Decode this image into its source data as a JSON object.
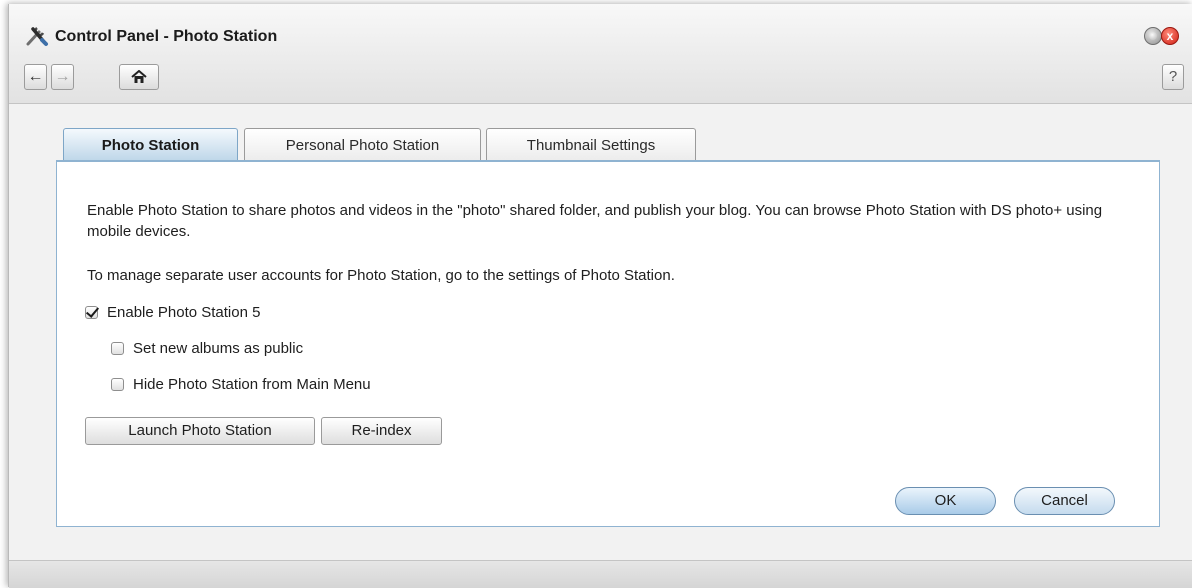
{
  "window": {
    "title": "Control Panel - Photo Station",
    "app_icon": "control-panel-tools-icon",
    "controls": {
      "minimize_icon": "minimize-icon",
      "close_icon": "close-icon",
      "close_glyph": "x"
    }
  },
  "toolbar": {
    "back_glyph": "←",
    "forward_glyph": "→",
    "home_glyph": "⌂",
    "help_label": "?"
  },
  "tabs": [
    {
      "label": "Photo Station",
      "active": true
    },
    {
      "label": "Personal Photo Station",
      "active": false
    },
    {
      "label": "Thumbnail Settings",
      "active": false
    }
  ],
  "content": {
    "description": "Enable Photo Station to share photos and videos in the \"photo\" shared folder, and publish your blog. You can browse Photo Station with DS photo+ using mobile devices.",
    "accounts_note": "To manage separate user accounts for Photo Station, go to the settings of Photo Station.",
    "options": [
      {
        "label": "Enable Photo Station 5",
        "checked": true
      },
      {
        "label": "Set new albums as public",
        "checked": false
      },
      {
        "label": "Hide Photo Station from Main Menu",
        "checked": false
      }
    ],
    "buttons": {
      "launch": "Launch Photo Station",
      "reindex": "Re-index"
    }
  },
  "dialog_buttons": {
    "ok": "OK",
    "cancel": "Cancel"
  },
  "colors": {
    "active_tab": "#bcd5e8",
    "panel_border": "#8fb3d1",
    "close_button": "#cf1e12"
  }
}
